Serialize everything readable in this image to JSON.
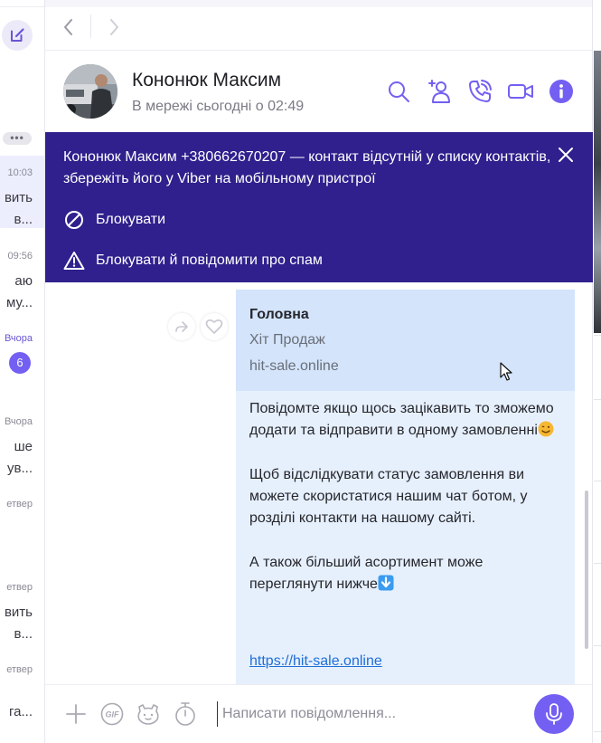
{
  "conversation_list": {
    "items": [
      {
        "time": "10:03",
        "lines": [
          "вить",
          "в..."
        ],
        "active": true
      },
      {
        "time": "09:56",
        "lines": [
          "аю",
          "му..."
        ]
      },
      {
        "time": "Вчора",
        "unread": "6"
      },
      {
        "time": "Вчора",
        "lines": [
          "ше",
          "ув..."
        ]
      },
      {
        "time": "етвер",
        "lines": []
      },
      {
        "time": "етвер",
        "lines": [
          "вить",
          "в..."
        ]
      },
      {
        "time": "етвер",
        "lines": [
          "га..."
        ]
      }
    ],
    "more": "•••"
  },
  "chat": {
    "contact_name": "Кононюк Максим",
    "status": "В мережі сьогодні о 02:49"
  },
  "banner": {
    "text": "Кононюк Максим +380662670207 — контакт відсутній у списку контактів, збережіть його у Viber на мобільному пристрої",
    "block_label": "Блокувати",
    "block_spam_label": "Блокувати й повідомити про спам"
  },
  "message": {
    "preview": {
      "title": "Головна",
      "subtitle": "Хіт Продаж",
      "domain": "hit-sale.online"
    },
    "paragraphs": [
      "Повідомте якщо щось зацікавить то зможемо додати та відправити в одному замовленні",
      "Щоб відслідкувати статус замовлення ви можете скористатися нашим чат ботом, у розділі контакти на нашому сайті.",
      "А також більший асортимент може переглянути  нижче"
    ],
    "link": "https://hit-sale.online"
  },
  "composer": {
    "placeholder": "Написати повідомлення..."
  },
  "colors": {
    "accent": "#7360f2",
    "banner": "#2f208d",
    "bubble": "#e6f0fd",
    "preview": "#d3e4fb",
    "link": "#1f6fd6"
  },
  "icons": [
    "compose-icon",
    "back-arrow-icon",
    "forward-arrow-icon",
    "search-icon",
    "add-participant-icon",
    "call-icon",
    "video-call-icon",
    "info-icon",
    "close-icon",
    "block-icon",
    "warning-icon",
    "forward-icon",
    "like-heart-icon",
    "plus-icon",
    "gif-icon",
    "sticker-icon",
    "timer-icon",
    "microphone-icon",
    "winking-emoji-icon",
    "down-arrow-emoji-icon"
  ]
}
